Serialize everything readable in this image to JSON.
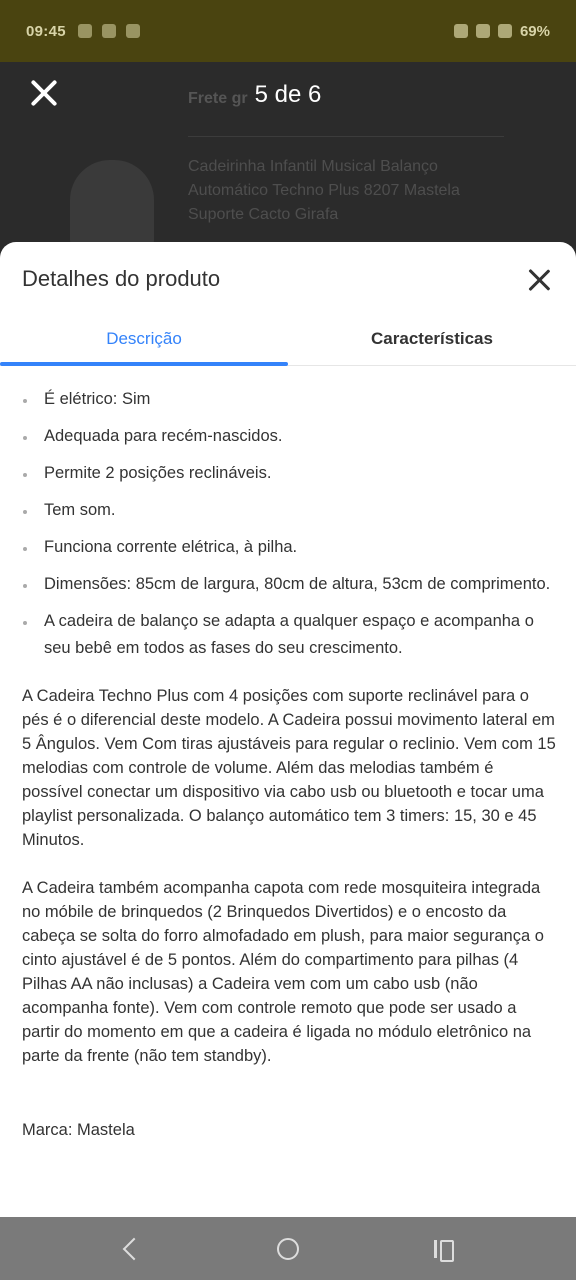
{
  "status_bar": {
    "time": "09:45",
    "battery": "69%"
  },
  "gallery": {
    "counter": "5 de 6",
    "shipping_partial": "Frete gr",
    "product_title": "Cadeirinha Infantil Musical Balanço Automático Techno Plus 8207 Mastela Suporte Cacto Girafa"
  },
  "sheet": {
    "title": "Detalhes do produto",
    "tabs": {
      "description": "Descrição",
      "characteristics": "Características"
    },
    "bullets": [
      "É elétrico: Sim",
      "Adequada para recém-nascidos.",
      "Permite 2 posições reclináveis.",
      "Tem som.",
      "Funciona corrente elétrica, à pilha.",
      "Dimensões: 85cm de largura, 80cm de altura, 53cm de comprimento.",
      "A cadeira de balanço se adapta a qualquer espaço e acompanha o seu bebê em todos as fases do seu crescimento."
    ],
    "paragraph_1": "A Cadeira Techno Plus com 4 posições com suporte reclinável para o pés é o diferencial deste modelo. A Cadeira possui movimento lateral em 5 Ângulos. Vem Com tiras ajustáveis para regular o reclinio. Vem com 15 melodias com controle de volume. Além das melodias também é possível conectar um dispositivo via cabo usb ou bluetooth e tocar uma playlist personalizada. O balanço automático tem 3 timers: 15, 30 e 45 Minutos.",
    "paragraph_2": "A Cadeira também acompanha capota com rede mosquiteira integrada no móbile de brinquedos (2 Brinquedos Divertidos) e o encosto da cabeça se solta do forro almofadado em plush, para maior segurança o cinto ajustável é de 5 pontos. Além do compartimento para pilhas (4 Pilhas AA não inclusas) a Cadeira vem com um cabo usb (não acompanha fonte). Vem com controle remoto que pode ser usado a partir do momento em que a cadeira é ligada no módulo eletrônico na parte da frente (não tem standby).",
    "brand": "Marca: Mastela"
  },
  "colors": {
    "accent": "#3483fa",
    "status_bar": "#4a4410",
    "nav_bar": "#7a7a7a"
  }
}
